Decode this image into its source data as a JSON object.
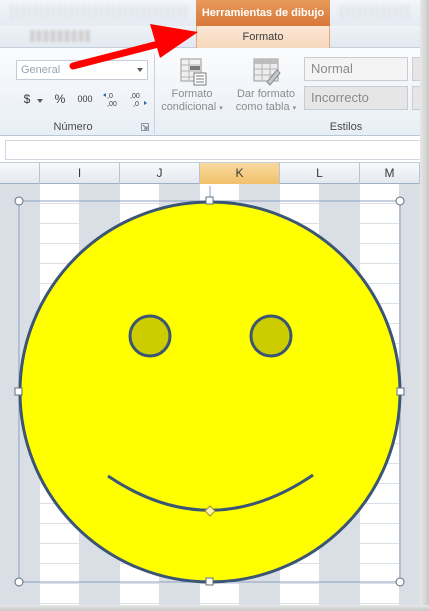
{
  "window": {
    "context_group_title": "Herramientas de dibujo",
    "context_tab": "Formato"
  },
  "ribbon": {
    "number_group": {
      "label": "Número",
      "format_select": {
        "value": "General"
      },
      "currency_symbol": "$",
      "percent_symbol": "%",
      "thousands_symbol": "000",
      "increase_decimals": "←,0 ,00",
      "decrease_decimals": ",00 →,0"
    },
    "styles_group": {
      "label": "Estilos",
      "conditional_format": {
        "line1": "Formato",
        "line2": "condicional"
      },
      "format_as_table": {
        "line1": "Dar formato",
        "line2": "como tabla"
      },
      "cell_styles": [
        "Normal",
        "Incorrecto"
      ]
    }
  },
  "sheet": {
    "columns": [
      "I",
      "J",
      "K",
      "L",
      "M"
    ],
    "selected_column": "K"
  },
  "shape": {
    "type": "smiley-face",
    "fill": "#ffff00",
    "outline": "#3b5575",
    "eye_fill": "#cccc00"
  },
  "annotation": {
    "arrow_color": "#ff0000"
  }
}
